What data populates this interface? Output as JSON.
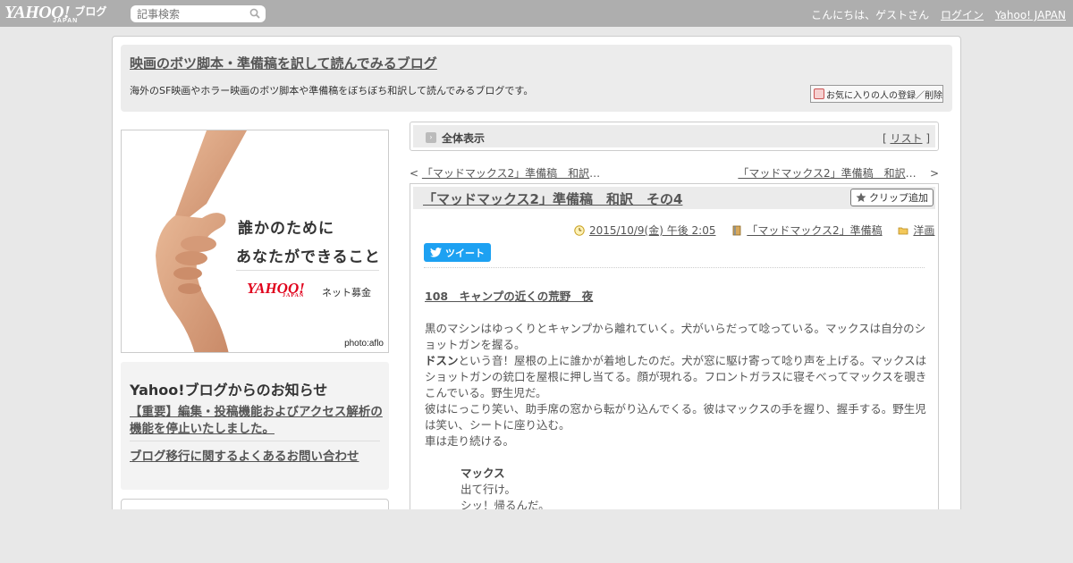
{
  "topbar": {
    "logo_text": "YAHOO!",
    "logo_japan": "JAPAN",
    "logo_blog": "ブログ",
    "search_placeholder": "記事検索",
    "greeting": "こんにちは、ゲストさん",
    "login": "ログイン",
    "yahoo_japan": "Yahoo! JAPAN"
  },
  "header": {
    "title": "映画のボツ脚本・準備稿を訳して読んでみるブログ",
    "description": "海外のSF映画やホラー映画のボツ脚本や準備稿をぼちぼち和訳して読んでみるブログです。",
    "fav_button": "お気に入りの人の登録／削除"
  },
  "banner": {
    "line1": "誰かのために",
    "line2": "あなたができること",
    "logo": "YAHOO!",
    "logo_sub": "JAPAN",
    "net": "ネット募金",
    "credit": "photo:aflo"
  },
  "notice": {
    "title": "Yahoo!ブログからのお知らせ",
    "link1": "【重要】編集・投稿機能およびアクセス解析の機能を停止いたしました。",
    "link2": "ブログ移行に関するよくあるお問い合わせ"
  },
  "viewbar": {
    "label": "全体表示",
    "list_open": "[ ",
    "list": "リスト",
    "list_close": " ]"
  },
  "nav": {
    "prev_arrow": "<",
    "prev": "「マッドマックス2」準備稿　和訳",
    "prev_ellipsis": "…",
    "next": "「マッドマックス2」準備稿　和訳",
    "next_ellipsis": "…",
    "next_arrow": ">"
  },
  "article": {
    "title": "「マッドマックス2」準備稿　和訳　その4",
    "clip_button": "クリップ追加",
    "date": "2015/10/9(金) 午後 2:05",
    "category": "「マッドマックス2」準備稿",
    "genre": "洋画",
    "tweet": "ツイート",
    "heading": "108　キャンプの近くの荒野　夜",
    "para1": "黒のマシンはゆっくりとキャンプから離れていく。犬がいらだって唸っている。マックスは自分のショットガンを握る。",
    "para2_bold": "ドスン",
    "para2_rest": "という音！屋根の上に誰かが着地したのだ。犬が窓に駆け寄って唸り声を上げる。マックスはショットガンの銃口を屋根に押し当てる。顔が現れる。フロントガラスに寝そべってマックスを覗きこんでいる。野生児だ。",
    "para3": "彼はにっこり笑い、助手席の窓から転がり込んでくる。彼はマックスの手を握り、握手する。野生児は笑い、シートに座り込む。",
    "para4": "車は走り続ける。",
    "speaker": "マックス",
    "line1": "出て行け。",
    "line2": "シッ！帰るんだ。"
  },
  "colors": {
    "topbar_bg": "#aeaeae",
    "tweet_blue": "#1da1f2",
    "banner_red": "#e0001b"
  }
}
